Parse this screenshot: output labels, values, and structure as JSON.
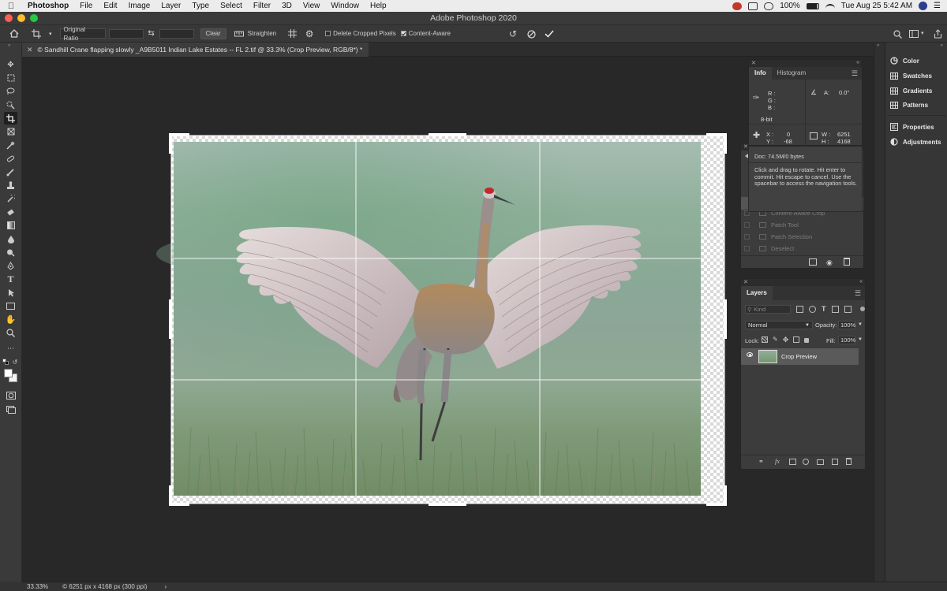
{
  "menubar": {
    "app": "Photoshop",
    "items": [
      "File",
      "Edit",
      "Image",
      "Layer",
      "Type",
      "Select",
      "Filter",
      "3D",
      "View",
      "Window",
      "Help"
    ],
    "battery": "100%",
    "datetime": "Tue Aug 25  5:42 AM"
  },
  "window": {
    "title": "Adobe Photoshop 2020"
  },
  "options": {
    "ratio": "Original Ratio",
    "clear": "Clear",
    "straighten": "Straighten",
    "delete_cropped": "Delete Cropped Pixels",
    "content_aware": "Content-Aware"
  },
  "document": {
    "tab_title": "© Sandhill Crane flapping slowly _A9B5011 Indian Lake Estates -- FL 2.tif @ 33.3% (Crop Preview, RGB/8*) *"
  },
  "status": {
    "zoom": "33.33%",
    "info": "© 6251 px x 4168 px (300 ppi)"
  },
  "info_panel": {
    "tabs": [
      "Info",
      "Histogram"
    ],
    "r": "R :",
    "g": "G :",
    "b": "B :",
    "bitdepth": "8-bit",
    "a_label": "A:",
    "a_value": "0.0°",
    "x_label": "X :",
    "x_value": "0",
    "y_label": "Y :",
    "y_value": "-68",
    "w_label": "W :",
    "w_value": "6251",
    "h_label": "H :",
    "h_value": "4168",
    "doc": "Doc: 74.5M/0 bytes",
    "hint": "Click and drag to rotate. Hit enter to commit. Hit escape to cancel. Use the spacebar to access the navigation tools."
  },
  "history_panel": {
    "items": [
      "Content-Aware Crop",
      "Patch Tool",
      "Patch Selection",
      "Deselect"
    ]
  },
  "layers_panel": {
    "title": "Layers",
    "kind": "Kind",
    "blend": "Normal",
    "opacity_label": "Opacity:",
    "opacity_value": "100%",
    "lock_label": "Lock:",
    "fill_label": "Fill:",
    "fill_value": "100%",
    "layer_name": "Crop Preview"
  },
  "collapsed_panels": [
    "Color",
    "Swatches",
    "Gradients",
    "Patterns",
    "Properties",
    "Adjustments"
  ]
}
